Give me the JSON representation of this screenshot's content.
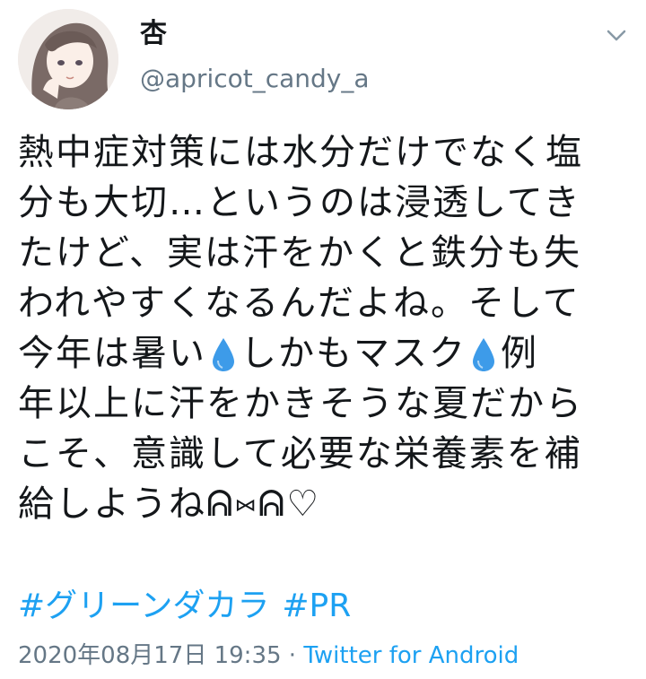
{
  "user": {
    "display_name": "杏",
    "handle": "@apricot_candy_a"
  },
  "tweet": {
    "line1": "熱中症対策には水分だけでなく塩",
    "line2": "分も大切…というのは浸透してき",
    "line3": "たけど、実は汗をかくと鉄分も失",
    "line4": "われやすくなるんだよね。そして",
    "line5_a": "今年は暑い",
    "line5_b": "しかもマスク",
    "line5_c": "例",
    "line6": "年以上に汗をかきそうな夏だから",
    "line7": "こそ、意識して必要な栄養素を補",
    "line8": "給しようねᕱ⑅ᕱ♡",
    "hashtags": [
      "#グリーンダカラ",
      "#PR"
    ]
  },
  "meta": {
    "date": "2020年08月17日 19:35",
    "separator": " · ",
    "source": "Twitter for Android"
  },
  "icons": {
    "avatar": "anime-girl-avatar",
    "menu": "chevron-down-icon",
    "droplet": "droplet-emoji"
  },
  "colors": {
    "link": "#1da1f2",
    "secondary_text": "#657786",
    "primary_text": "#14171a",
    "droplet": "#3d9be9"
  }
}
